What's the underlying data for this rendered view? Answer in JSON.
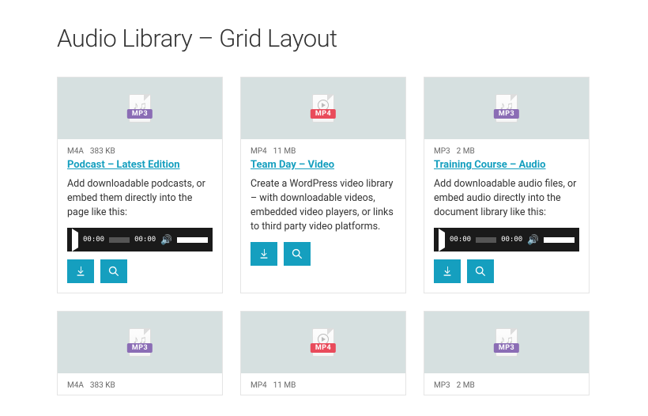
{
  "page_title": "Audio Library – Grid Layout",
  "player": {
    "time_start": "00:00",
    "time_end": "00:00",
    "speaker_glyph": "🔊"
  },
  "items": [
    {
      "type": "MP3",
      "badge_class": "badge-mp3",
      "icon": "music",
      "format": "M4A",
      "size": "383 KB",
      "title": "Podcast – Latest Edition",
      "desc": "Add downloadable podcasts, or embed them directly into the page like this:",
      "has_player": true
    },
    {
      "type": "MP4",
      "badge_class": "badge-mp4",
      "icon": "video",
      "format": "MP4",
      "size": "11 MB",
      "title": "Team Day – Video",
      "desc": "Create a WordPress video library – with downloadable videos, embedded video players, or links to third party video platforms.",
      "has_player": false
    },
    {
      "type": "MP3",
      "badge_class": "badge-mp3",
      "icon": "music",
      "format": "MP3",
      "size": "2 MB",
      "title": "Training Course – Audio",
      "desc": "Add downloadable audio files, or embed audio directly into the document library like this:",
      "has_player": true
    }
  ]
}
